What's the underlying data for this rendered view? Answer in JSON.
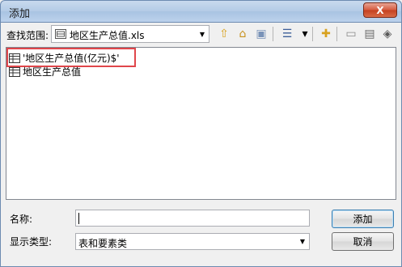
{
  "window": {
    "title": "添加",
    "close_glyph": "X"
  },
  "toolbar": {
    "lookin_label": "查找范围:",
    "lookin_value": "地区生产总值.xls",
    "buttons": [
      {
        "name": "up-folder-icon",
        "glyph": "⇧",
        "color": "#d8a11e"
      },
      {
        "name": "home-icon",
        "glyph": "⌂",
        "color": "#c8901a"
      },
      {
        "name": "connect-folder-icon",
        "glyph": "▣",
        "color": "#7a93b8"
      },
      {
        "name": "view-list-icon",
        "glyph": "☰",
        "color": "#3d5f99"
      },
      {
        "name": "view-dropdown-icon",
        "glyph": "▾",
        "color": "#000000"
      },
      {
        "name": "new-folder-icon",
        "glyph": "✚",
        "color": "#d8a11e"
      },
      {
        "name": "catalog-icon",
        "glyph": "▭",
        "color": "#8a8a8a"
      },
      {
        "name": "database-icon",
        "glyph": "▤",
        "color": "#6a6a6a"
      },
      {
        "name": "toolbox-icon",
        "glyph": "◈",
        "color": "#5a5a5a"
      }
    ]
  },
  "files": [
    {
      "label": "'地区生产总值(亿元)$'"
    },
    {
      "label": "地区生产总值"
    }
  ],
  "form": {
    "name_label": "名称:",
    "name_value": "",
    "type_label": "显示类型:",
    "type_value": "表和要素类"
  },
  "actions": {
    "add_label": "添加",
    "cancel_label": "取消"
  },
  "colors": {
    "highlight": "#e0464b",
    "title_bar": "#b3cbe6",
    "close": "#d55a3e"
  }
}
